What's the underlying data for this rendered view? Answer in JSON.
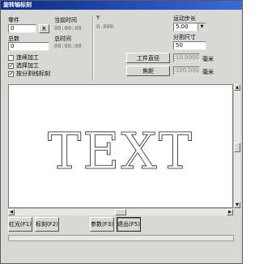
{
  "window": {
    "title": "旋转轴标刻"
  },
  "counters": {
    "parts_label": "零件",
    "parts_value": "0",
    "reset_label": "R",
    "total_label": "总数",
    "total_value": "0",
    "current_time_label": "当前时间",
    "current_time_value": "00:00:00",
    "total_time_label": "总时间",
    "total_time_value": "00:00:00"
  },
  "position": {
    "y_label": "Y",
    "y_value": "0.000"
  },
  "options": [
    {
      "label": "连续加工",
      "checked": false
    },
    {
      "label": "选择加工",
      "checked": true
    },
    {
      "label": "按分割线标刻",
      "checked": true
    }
  ],
  "motion": {
    "step_label": "运动步长",
    "step_value": "5.00",
    "split_label": "分割尺寸",
    "split_value": "50",
    "diameter_button": "工件直径",
    "diameter_value": "10.000000",
    "diameter_unit": "毫米",
    "focus_button": "焦距",
    "focus_value": "100.000000",
    "focus_unit": "毫米"
  },
  "preview": {
    "text": "TEXT"
  },
  "buttons": {
    "red_light": "红光(F1)",
    "mark": "标刻(F2)",
    "params": "参数(F3)",
    "exit": "退出(F5)"
  },
  "colors": {
    "title_start": "#0a2a8a",
    "title_end": "#3a6ad8",
    "panel": "#d8d8d4"
  }
}
